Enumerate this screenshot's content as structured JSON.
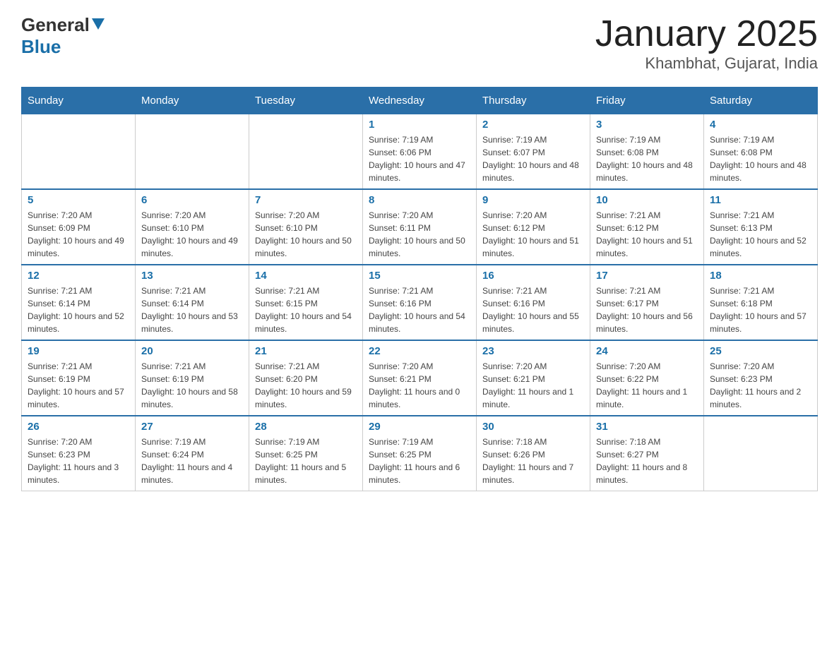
{
  "header": {
    "logo_line1": "General",
    "logo_line2": "Blue",
    "title": "January 2025",
    "subtitle": "Khambhat, Gujarat, India"
  },
  "days_of_week": [
    "Sunday",
    "Monday",
    "Tuesday",
    "Wednesday",
    "Thursday",
    "Friday",
    "Saturday"
  ],
  "weeks": [
    [
      {
        "day": "",
        "info": ""
      },
      {
        "day": "",
        "info": ""
      },
      {
        "day": "",
        "info": ""
      },
      {
        "day": "1",
        "info": "Sunrise: 7:19 AM\nSunset: 6:06 PM\nDaylight: 10 hours and 47 minutes."
      },
      {
        "day": "2",
        "info": "Sunrise: 7:19 AM\nSunset: 6:07 PM\nDaylight: 10 hours and 48 minutes."
      },
      {
        "day": "3",
        "info": "Sunrise: 7:19 AM\nSunset: 6:08 PM\nDaylight: 10 hours and 48 minutes."
      },
      {
        "day": "4",
        "info": "Sunrise: 7:19 AM\nSunset: 6:08 PM\nDaylight: 10 hours and 48 minutes."
      }
    ],
    [
      {
        "day": "5",
        "info": "Sunrise: 7:20 AM\nSunset: 6:09 PM\nDaylight: 10 hours and 49 minutes."
      },
      {
        "day": "6",
        "info": "Sunrise: 7:20 AM\nSunset: 6:10 PM\nDaylight: 10 hours and 49 minutes."
      },
      {
        "day": "7",
        "info": "Sunrise: 7:20 AM\nSunset: 6:10 PM\nDaylight: 10 hours and 50 minutes."
      },
      {
        "day": "8",
        "info": "Sunrise: 7:20 AM\nSunset: 6:11 PM\nDaylight: 10 hours and 50 minutes."
      },
      {
        "day": "9",
        "info": "Sunrise: 7:20 AM\nSunset: 6:12 PM\nDaylight: 10 hours and 51 minutes."
      },
      {
        "day": "10",
        "info": "Sunrise: 7:21 AM\nSunset: 6:12 PM\nDaylight: 10 hours and 51 minutes."
      },
      {
        "day": "11",
        "info": "Sunrise: 7:21 AM\nSunset: 6:13 PM\nDaylight: 10 hours and 52 minutes."
      }
    ],
    [
      {
        "day": "12",
        "info": "Sunrise: 7:21 AM\nSunset: 6:14 PM\nDaylight: 10 hours and 52 minutes."
      },
      {
        "day": "13",
        "info": "Sunrise: 7:21 AM\nSunset: 6:14 PM\nDaylight: 10 hours and 53 minutes."
      },
      {
        "day": "14",
        "info": "Sunrise: 7:21 AM\nSunset: 6:15 PM\nDaylight: 10 hours and 54 minutes."
      },
      {
        "day": "15",
        "info": "Sunrise: 7:21 AM\nSunset: 6:16 PM\nDaylight: 10 hours and 54 minutes."
      },
      {
        "day": "16",
        "info": "Sunrise: 7:21 AM\nSunset: 6:16 PM\nDaylight: 10 hours and 55 minutes."
      },
      {
        "day": "17",
        "info": "Sunrise: 7:21 AM\nSunset: 6:17 PM\nDaylight: 10 hours and 56 minutes."
      },
      {
        "day": "18",
        "info": "Sunrise: 7:21 AM\nSunset: 6:18 PM\nDaylight: 10 hours and 57 minutes."
      }
    ],
    [
      {
        "day": "19",
        "info": "Sunrise: 7:21 AM\nSunset: 6:19 PM\nDaylight: 10 hours and 57 minutes."
      },
      {
        "day": "20",
        "info": "Sunrise: 7:21 AM\nSunset: 6:19 PM\nDaylight: 10 hours and 58 minutes."
      },
      {
        "day": "21",
        "info": "Sunrise: 7:21 AM\nSunset: 6:20 PM\nDaylight: 10 hours and 59 minutes."
      },
      {
        "day": "22",
        "info": "Sunrise: 7:20 AM\nSunset: 6:21 PM\nDaylight: 11 hours and 0 minutes."
      },
      {
        "day": "23",
        "info": "Sunrise: 7:20 AM\nSunset: 6:21 PM\nDaylight: 11 hours and 1 minute."
      },
      {
        "day": "24",
        "info": "Sunrise: 7:20 AM\nSunset: 6:22 PM\nDaylight: 11 hours and 1 minute."
      },
      {
        "day": "25",
        "info": "Sunrise: 7:20 AM\nSunset: 6:23 PM\nDaylight: 11 hours and 2 minutes."
      }
    ],
    [
      {
        "day": "26",
        "info": "Sunrise: 7:20 AM\nSunset: 6:23 PM\nDaylight: 11 hours and 3 minutes."
      },
      {
        "day": "27",
        "info": "Sunrise: 7:19 AM\nSunset: 6:24 PM\nDaylight: 11 hours and 4 minutes."
      },
      {
        "day": "28",
        "info": "Sunrise: 7:19 AM\nSunset: 6:25 PM\nDaylight: 11 hours and 5 minutes."
      },
      {
        "day": "29",
        "info": "Sunrise: 7:19 AM\nSunset: 6:25 PM\nDaylight: 11 hours and 6 minutes."
      },
      {
        "day": "30",
        "info": "Sunrise: 7:18 AM\nSunset: 6:26 PM\nDaylight: 11 hours and 7 minutes."
      },
      {
        "day": "31",
        "info": "Sunrise: 7:18 AM\nSunset: 6:27 PM\nDaylight: 11 hours and 8 minutes."
      },
      {
        "day": "",
        "info": ""
      }
    ]
  ]
}
